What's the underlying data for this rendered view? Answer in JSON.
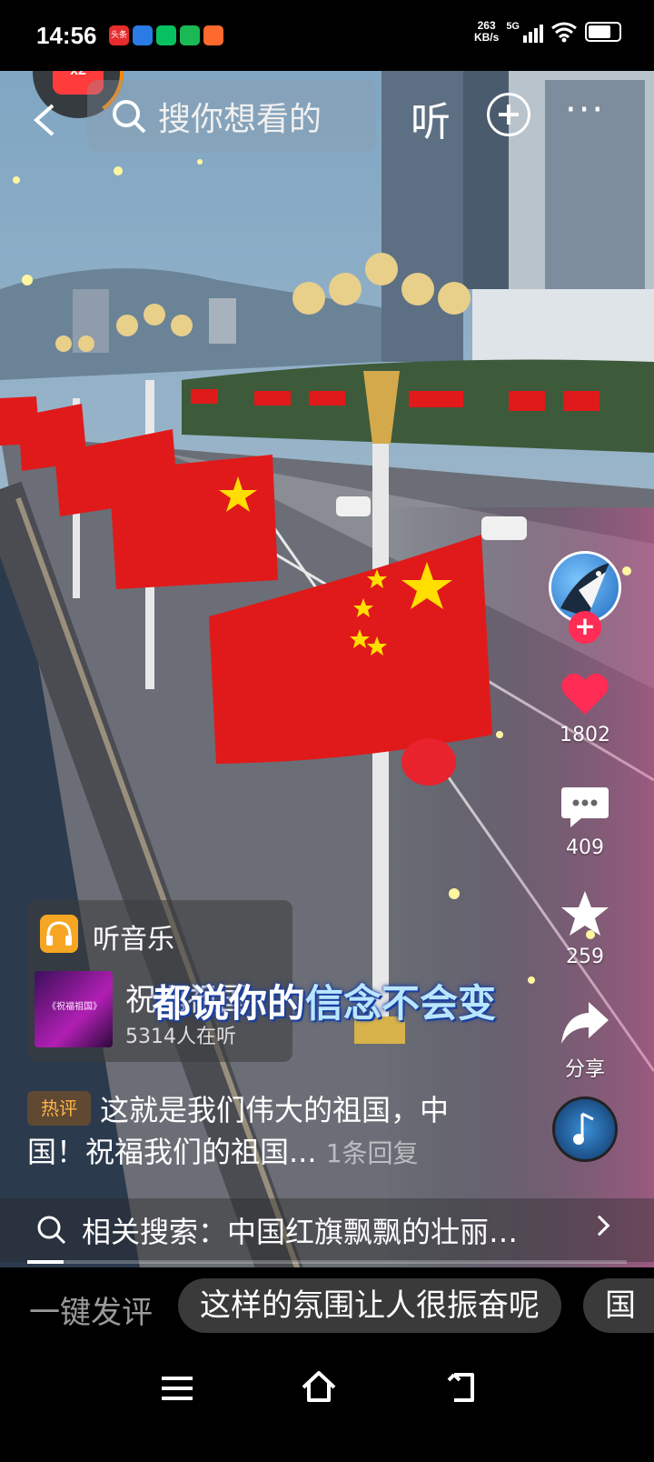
{
  "status_bar": {
    "time": "14:56",
    "apps": [
      {
        "icon": "toutiao-icon",
        "label": "头条",
        "color": "#e62c2c"
      },
      {
        "icon": "app-blue-icon",
        "label": "",
        "color": "#2a7be4"
      },
      {
        "icon": "wechat-icon",
        "label": "",
        "color": "#07c160"
      },
      {
        "icon": "app-green-icon",
        "label": "",
        "color": "#1bb954"
      },
      {
        "icon": "app-orange-icon",
        "label": "",
        "color": "#ff6a2c"
      }
    ],
    "net_speed_value": "263",
    "net_speed_unit": "KB/s",
    "signal_label": "5G",
    "battery_level": 0.75
  },
  "top_bar": {
    "coin_badge": "x2",
    "search_placeholder": "搜你想看的",
    "listen_label": "听"
  },
  "right_rail": {
    "like_count": "1802",
    "comment_count": "409",
    "favorite_count": "259",
    "share_label": "分享"
  },
  "music_card": {
    "title": "听音乐",
    "cover_text": "《祝福祖国》",
    "song": "祝福祖国",
    "listeners": "5314人在听"
  },
  "subtitle": {
    "prefix": "都说你的",
    "highlight": "信念不会变"
  },
  "hot_comment": {
    "tag": "热评",
    "text": "这就是我们伟大的祖国，中国！祝福我们的祖国...",
    "reply": "1条回复"
  },
  "related_search": {
    "text": "相关搜索：中国红旗飘飘的壮丽…"
  },
  "playback_progress": 0.06,
  "comment_bar": {
    "quick_label": "一键发评",
    "chips": [
      "这样的氛围让人很振奋呢",
      "国"
    ]
  },
  "colors": {
    "like": "#ff2c55",
    "flag_red": "#e01a1a",
    "flag_star": "#ffde00"
  }
}
